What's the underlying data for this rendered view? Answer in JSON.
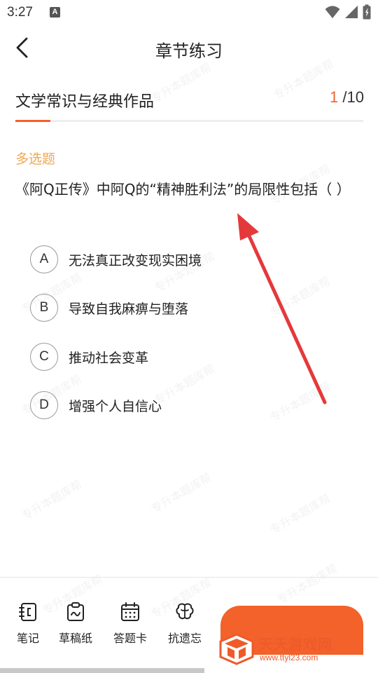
{
  "status_bar": {
    "time": "3:27",
    "notification_icon_letter": "A"
  },
  "header": {
    "title": "章节练习"
  },
  "section": {
    "title": "文学常识与经典作品",
    "current_question": "1",
    "total_questions": "/10",
    "progress_fraction": 0.1
  },
  "question": {
    "type": "多选题",
    "text": "《阿Q正传》中阿Q的“精神胜利法”的局限性包括（ ）",
    "options": [
      {
        "letter": "A",
        "text": "无法真正改变现实困境"
      },
      {
        "letter": "B",
        "text": "导致自我麻痹与堕落"
      },
      {
        "letter": "C",
        "text": "推动社会变革"
      },
      {
        "letter": "D",
        "text": "增强个人自信心"
      }
    ]
  },
  "watermark_text": "专升本题库帮",
  "toolbar": [
    {
      "label": "笔记",
      "icon": "notebook-icon"
    },
    {
      "label": "草稿纸",
      "icon": "clipboard-icon"
    },
    {
      "label": "答题卡",
      "icon": "calendar-grid-icon"
    },
    {
      "label": "抗遗忘",
      "icon": "brain-icon"
    }
  ],
  "brand": {
    "name": "天天游戏网",
    "url": "www.ttyl23.com"
  },
  "colors": {
    "accent": "#f2622a",
    "question_type": "#f0a84e",
    "arrow": "#e5383b"
  }
}
